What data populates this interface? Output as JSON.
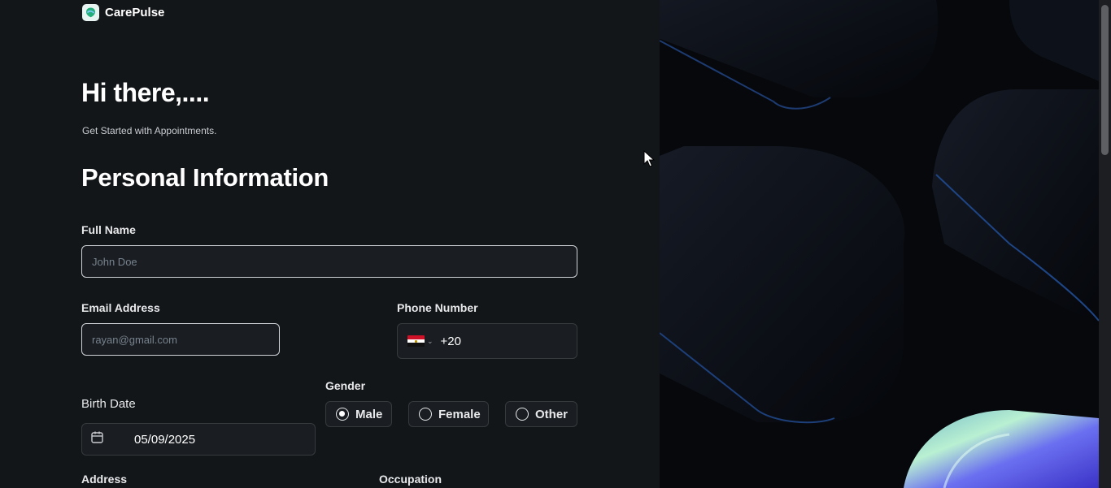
{
  "brand": {
    "name": "CarePulse"
  },
  "header": {
    "greeting": "Hi there,....",
    "subtitle": "Get Started with Appointments."
  },
  "section": {
    "title": "Personal Information"
  },
  "form": {
    "full_name": {
      "label": "Full Name",
      "placeholder": "John Doe",
      "value": ""
    },
    "email": {
      "label": "Email Address",
      "placeholder": "rayan@gmail.com",
      "value": ""
    },
    "phone": {
      "label": "Phone Number",
      "country": "Egypt",
      "code": "+20"
    },
    "birth_date": {
      "label": "Birth Date",
      "value": "05/09/2025"
    },
    "gender": {
      "label": "Gender",
      "options": [
        "Male",
        "Female",
        "Other"
      ],
      "selected": "Male"
    },
    "address": {
      "label": "Address"
    },
    "occupation": {
      "label": "Occupation"
    }
  },
  "icons": {
    "logo": "carepulse-logo-icon",
    "calendar": "calendar-icon",
    "flag": "egypt-flag-icon",
    "chevron": "chevron-down-icon",
    "cursor": "mouse-pointer-icon"
  },
  "colors": {
    "background": "#131619",
    "input_background": "#1a1d21",
    "input_border": "#363a3d",
    "focused_border": "#cfd2d6",
    "text": "#ffffff",
    "placeholder": "#76828d",
    "accent_green": "#24ae7c"
  }
}
